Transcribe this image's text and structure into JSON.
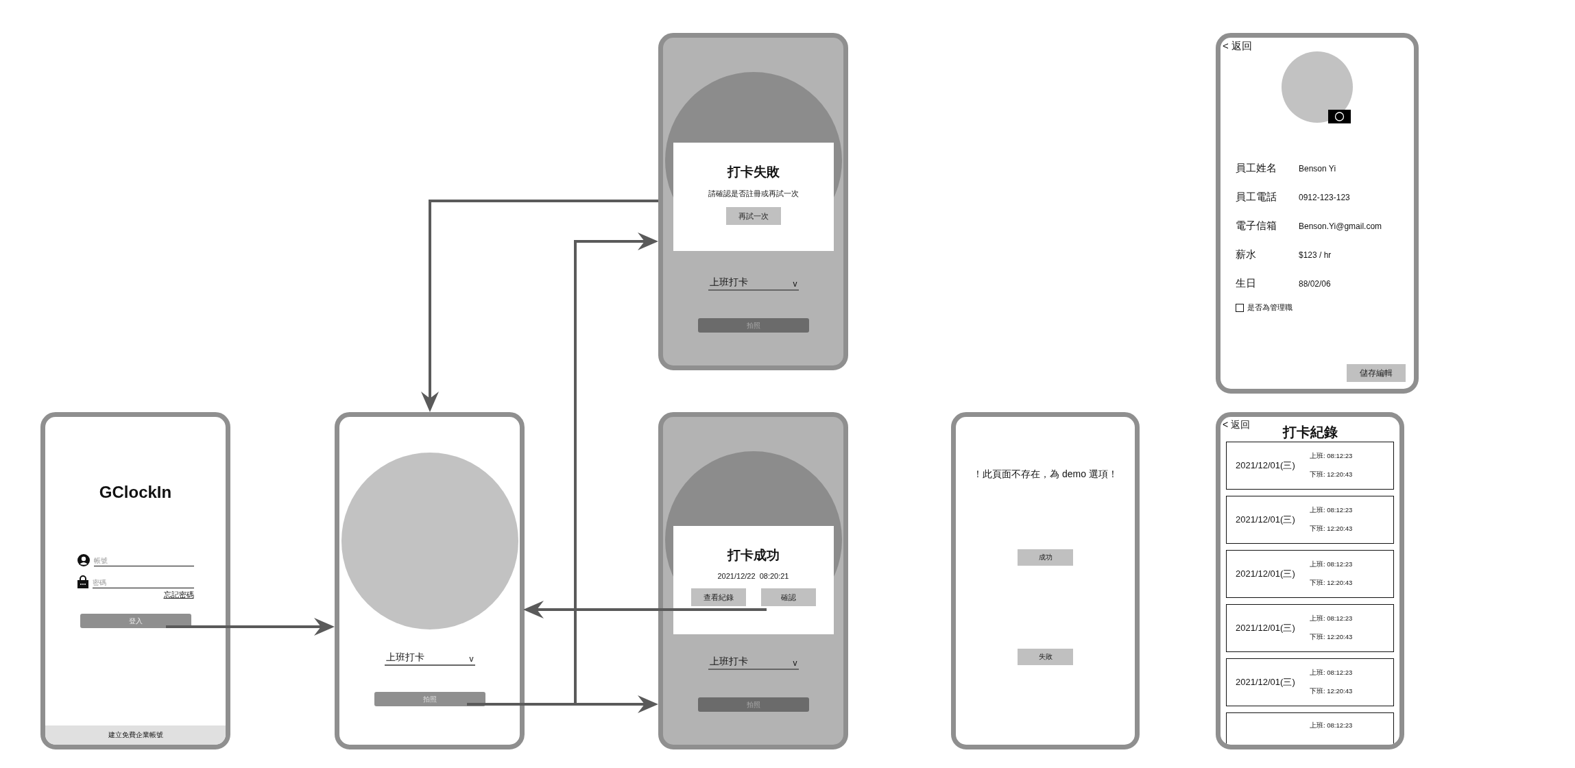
{
  "screens": [
    {
      "kind": "login",
      "title": "GClockIn",
      "fields": [
        {
          "kind": "account",
          "placeholder": "帳號"
        },
        {
          "kind": "password",
          "placeholder": "密碼"
        }
      ],
      "forgot_link": "忘記密碼",
      "login_button": "登入",
      "footer": "建立免費企業帳號"
    },
    {
      "kind": "camera",
      "dropdown": "上班打卡",
      "caret": "v",
      "button": "拍照"
    },
    {
      "kind": "result",
      "title": "打卡失敗",
      "message": "請確認是否註冊或再試一次",
      "buttons": [
        "再試一次"
      ],
      "dropdown": "上班打卡",
      "caret": "v",
      "button": "拍照"
    },
    {
      "kind": "result",
      "title": "打卡成功",
      "message": "2021/12/22  08:20:21",
      "buttons": [
        "查看紀錄",
        "確認"
      ],
      "dropdown": "上班打卡",
      "caret": "v",
      "button": "拍照"
    },
    {
      "kind": "demo",
      "message": "！此頁面不存在，為 demo 選項！",
      "buttons": [
        "成功",
        "失敗"
      ]
    },
    {
      "kind": "profile",
      "back": "< 返回",
      "fields": [
        {
          "label": "員工姓名",
          "value": "Benson Yi"
        },
        {
          "label": "員工電話",
          "value": "0912-123-123"
        },
        {
          "label": "電子信箱",
          "value": "Benson.Yi@gmail.com"
        },
        {
          "label": "薪水",
          "value": "$123 / hr"
        },
        {
          "label": "生日",
          "value": "88/02/06"
        }
      ],
      "checkbox": {
        "label": "是否為管理職",
        "checked": false
      },
      "save_button": "儲存編輯"
    },
    {
      "kind": "records",
      "back": "< 返回",
      "title": "打卡紀錄",
      "records": [
        {
          "date": "2021/12/01(三)",
          "clock_in": "上班: 08:12:23",
          "clock_out": "下班: 12:20:43"
        },
        {
          "date": "2021/12/01(三)",
          "clock_in": "上班: 08:12:23",
          "clock_out": "下班: 12:20:43"
        },
        {
          "date": "2021/12/01(三)",
          "clock_in": "上班: 08:12:23",
          "clock_out": "下班: 12:20:43"
        },
        {
          "date": "2021/12/01(三)",
          "clock_in": "上班: 08:12:23",
          "clock_out": "下班: 12:20:43"
        },
        {
          "date": "2021/12/01(三)",
          "clock_in": "上班: 08:12:23",
          "clock_out": "下班: 12:20:43"
        },
        {
          "clock_in": "上班: 08:12:23"
        }
      ]
    }
  ]
}
